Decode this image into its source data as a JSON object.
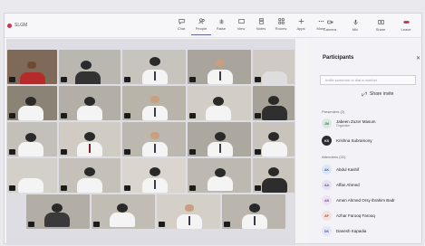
{
  "app": {
    "title": "SLGM"
  },
  "toolbar": [
    {
      "label": "Chat",
      "icon": "chat-icon"
    },
    {
      "label": "People",
      "icon": "people-icon",
      "active": true
    },
    {
      "label": "Raise",
      "icon": "hand-icon"
    },
    {
      "label": "View",
      "icon": "view-icon"
    },
    {
      "label": "Notes",
      "icon": "notes-icon"
    },
    {
      "label": "Rooms",
      "icon": "rooms-icon"
    },
    {
      "label": "Apps",
      "icon": "apps-icon"
    },
    {
      "label": "More",
      "icon": "more-icon"
    }
  ],
  "actions": [
    {
      "label": "Camera",
      "icon": "camera-icon"
    },
    {
      "label": "Mic",
      "icon": "mic-icon"
    },
    {
      "label": "Share",
      "icon": "share-icon"
    },
    {
      "label": "Leave",
      "icon": "leave-icon"
    }
  ],
  "participants_panel": {
    "title": "Participants",
    "search_placeholder": "Invite someone or dial a number",
    "share_invite": "Share invite",
    "presenters_label": "Presenters (2)",
    "attendees_label": "Attendees (22)",
    "presenters": [
      {
        "initials": "JM",
        "name": "Jabeen Zuzer Masum",
        "subtitle": "Organizer",
        "color": "#d9e8df",
        "text_color": "#3a7a57"
      },
      {
        "initials": "KS",
        "name": "Krishna Subramony",
        "subtitle": "",
        "color": "#2c2c34",
        "text_color": "#ffffff"
      }
    ],
    "attendees": [
      {
        "initials": "AK",
        "name": "Abdul Kashif",
        "color": "#dbe5f3",
        "text_color": "#3b5f98"
      },
      {
        "initials": "AA",
        "name": "Affan Ahmed",
        "color": "#e6e0f3",
        "text_color": "#5e4b96"
      },
      {
        "initials": "AB",
        "name": "Amen Ahmed Orsy Ibrahim Badr",
        "color": "#ece2f2",
        "text_color": "#7a4f96"
      },
      {
        "initials": "AF",
        "name": "Azhar Farooq Farooq",
        "color": "#f4e0dc",
        "text_color": "#a0473a"
      },
      {
        "initials": "DK",
        "name": "Danesh Kapadia",
        "color": "#e4e6f4",
        "text_color": "#4b569a"
      }
    ]
  }
}
